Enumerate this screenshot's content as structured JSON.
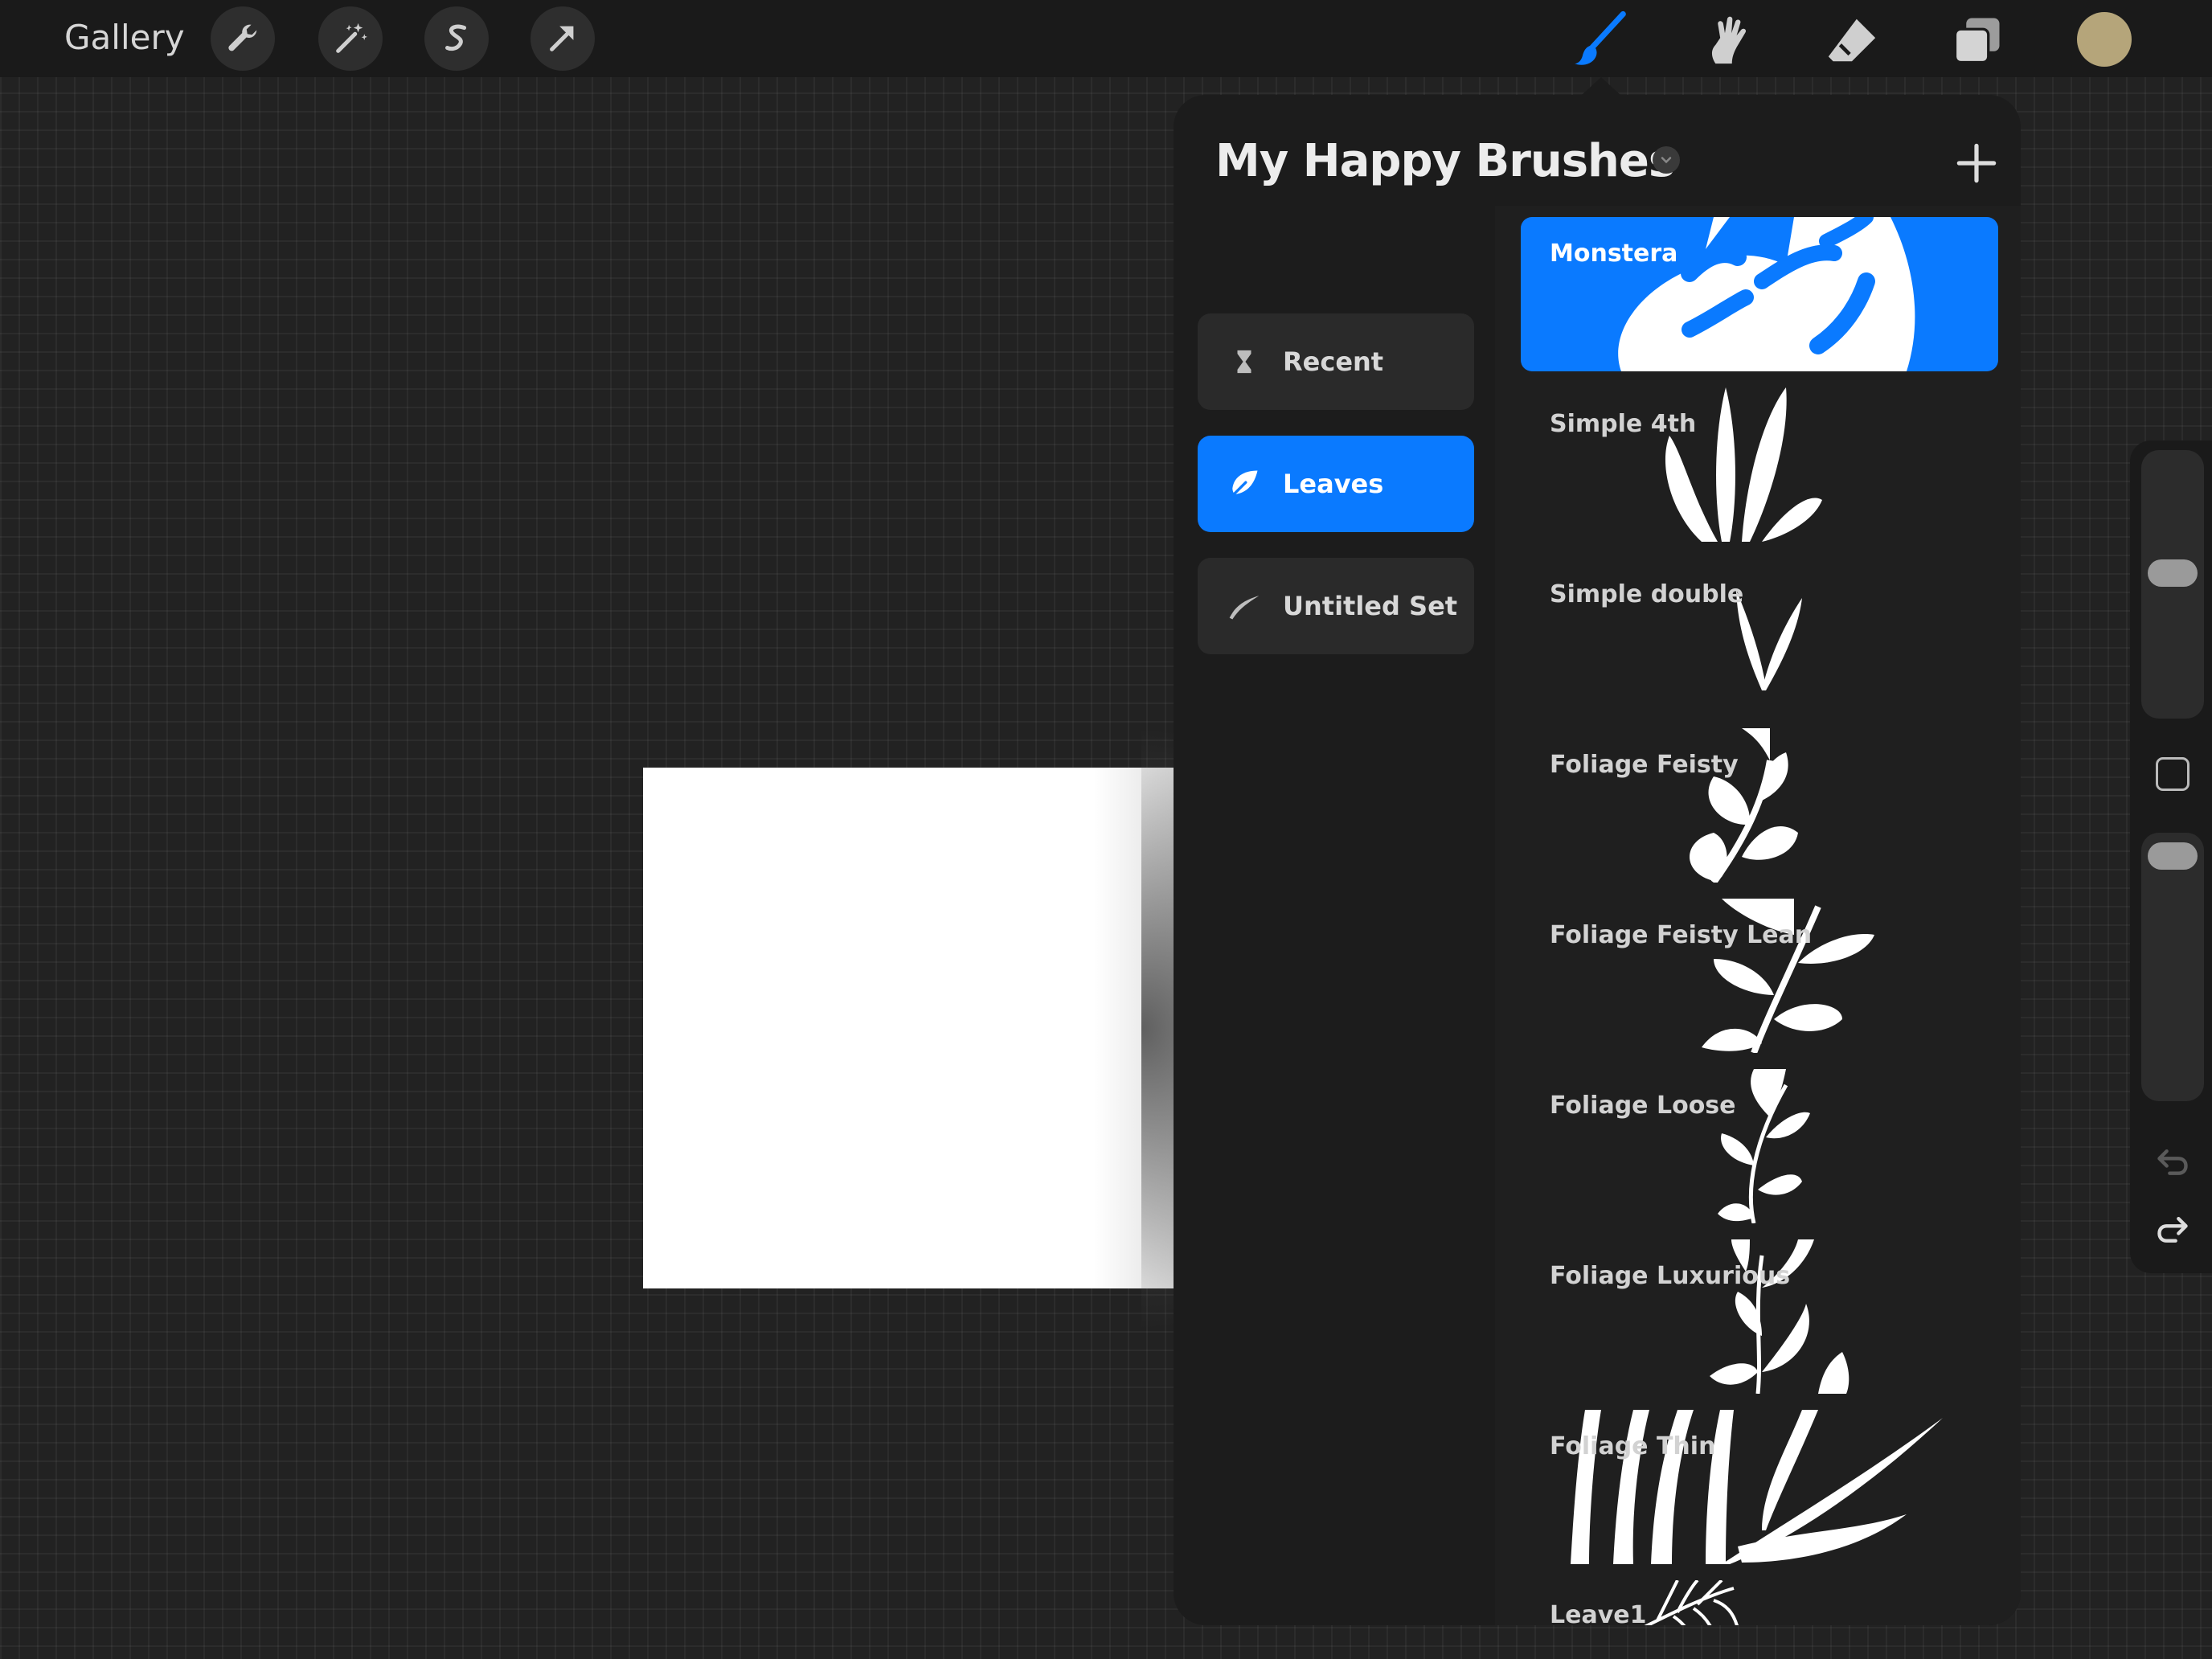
{
  "topbar": {
    "gallery_label": "Gallery",
    "left_tools": [
      "wrench-icon",
      "magic-wand-icon",
      "selection-s-icon",
      "transform-arrow-icon"
    ],
    "right_tools": [
      "brush-icon",
      "smudge-icon",
      "eraser-icon",
      "layers-icon"
    ],
    "active_tool": "brush-icon",
    "active_color": "#b5a57a"
  },
  "brush_library": {
    "title": "My Happy Brushes",
    "sets": [
      {
        "label": "Recent",
        "icon": "hourglass-icon"
      },
      {
        "label": "Leaves",
        "icon": "leaf-icon",
        "active": true
      },
      {
        "label": "Untitled Set",
        "icon": "brush-stroke-icon"
      }
    ],
    "brushes": [
      {
        "name": "Monstera",
        "active": true
      },
      {
        "name": "Simple 4th"
      },
      {
        "name": "Simple double"
      },
      {
        "name": "Foliage Feisty"
      },
      {
        "name": "Foliage Feisty Lean"
      },
      {
        "name": "Foliage Loose"
      },
      {
        "name": "Foliage Luxurious"
      },
      {
        "name": "Foliage Thin"
      },
      {
        "name": "Leave1"
      }
    ]
  },
  "colors": {
    "accent": "#0a7aff",
    "panel": "#1c1c1c",
    "toolbar": "#1a1a1a"
  }
}
